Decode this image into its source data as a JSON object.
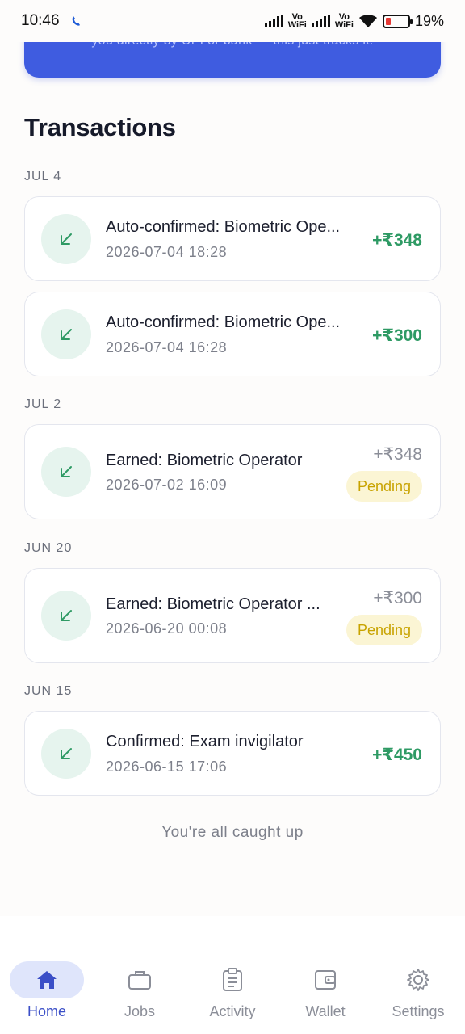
{
  "status": {
    "time": "10:46",
    "battery": "19%",
    "vo_label": "Vo",
    "wifi_label": "WiFi"
  },
  "banner": {
    "text": "you directly by UPI or bank — this just tracks it."
  },
  "page": {
    "title": "Transactions"
  },
  "groups": [
    {
      "date": "JUL 4"
    },
    {
      "date": "JUL 2"
    },
    {
      "date": "JUN 20"
    },
    {
      "date": "JUN 15"
    }
  ],
  "transactions": [
    {
      "title": "Auto-confirmed: Biometric Ope...",
      "time": "2026-07-04 18:28",
      "amount": "+₹348",
      "status": ""
    },
    {
      "title": "Auto-confirmed: Biometric Ope...",
      "time": "2026-07-04 16:28",
      "amount": "+₹300",
      "status": ""
    },
    {
      "title": "Earned: Biometric Operator",
      "time": "2026-07-02 16:09",
      "amount": "+₹348",
      "status": "Pending"
    },
    {
      "title": "Earned: Biometric Operator ...",
      "time": "2026-06-20 00:08",
      "amount": "+₹300",
      "status": "Pending"
    },
    {
      "title": "Confirmed: Exam invigilator",
      "time": "2026-06-15 17:06",
      "amount": "+₹450",
      "status": ""
    }
  ],
  "footer": {
    "text": "You're all caught up"
  },
  "nav": [
    {
      "label": "Home",
      "icon": "home-icon",
      "active": true
    },
    {
      "label": "Jobs",
      "icon": "briefcase-icon",
      "active": false
    },
    {
      "label": "Activity",
      "icon": "clipboard-icon",
      "active": false
    },
    {
      "label": "Wallet",
      "icon": "wallet-icon",
      "active": false
    },
    {
      "label": "Settings",
      "icon": "gear-icon",
      "active": false
    }
  ],
  "colors": {
    "accent": "#3f5ce0",
    "positive": "#2e9a64",
    "pending": "#c8a300"
  }
}
